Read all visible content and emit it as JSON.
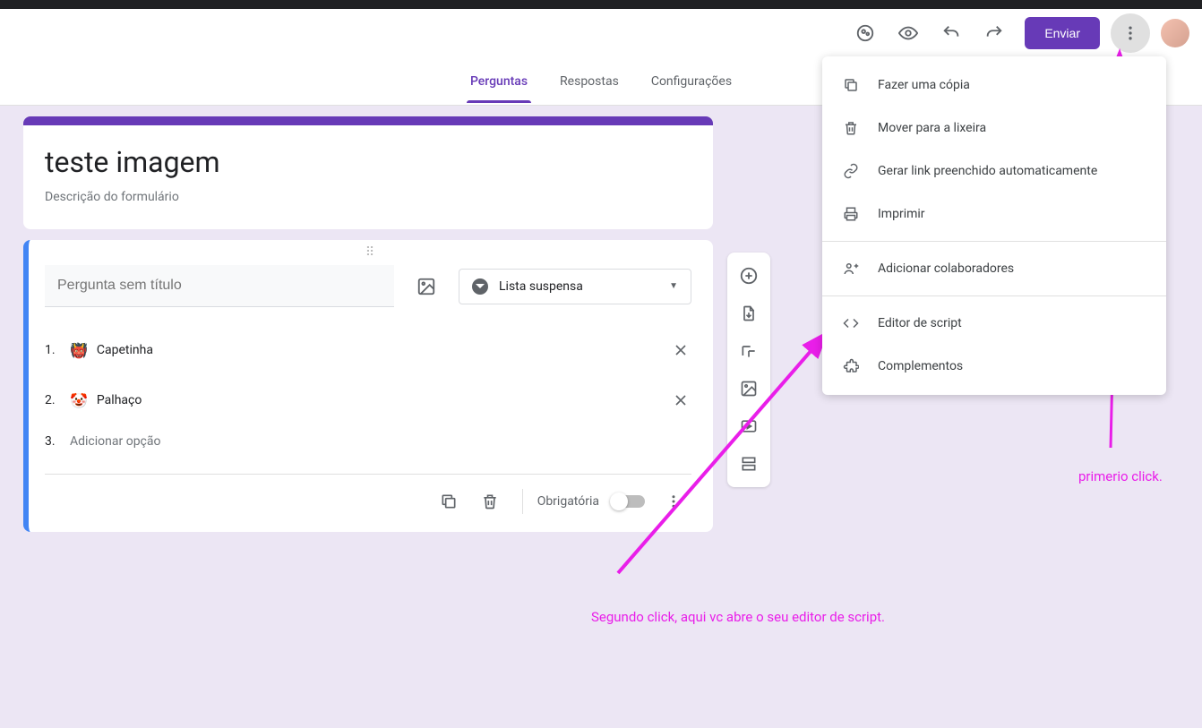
{
  "header": {
    "send_label": "Enviar"
  },
  "tabs": {
    "questions": "Perguntas",
    "responses": "Respostas",
    "settings": "Configurações"
  },
  "form": {
    "title": "teste imagem",
    "description_placeholder": "Descrição do formulário"
  },
  "question": {
    "title_placeholder": "Pergunta sem título",
    "type_label": "Lista suspensa",
    "options": [
      {
        "n": "1.",
        "emoji": "👹",
        "text": "Capetinha"
      },
      {
        "n": "2.",
        "emoji": "🤡",
        "text": "Palhaço"
      }
    ],
    "add_option_n": "3.",
    "add_option_text": "Adicionar opção",
    "required_label": "Obrigatória"
  },
  "menu": {
    "copy": "Fazer uma cópia",
    "trash": "Mover para a lixeira",
    "prefill": "Gerar link preenchido automaticamente",
    "print": "Imprimir",
    "collaborators": "Adicionar colaboradores",
    "script_editor": "Editor de script",
    "addons": "Complementos"
  },
  "annotations": {
    "first_click": "primerio click.",
    "second_click": "Segundo click, aqui vc abre o seu editor de script."
  }
}
